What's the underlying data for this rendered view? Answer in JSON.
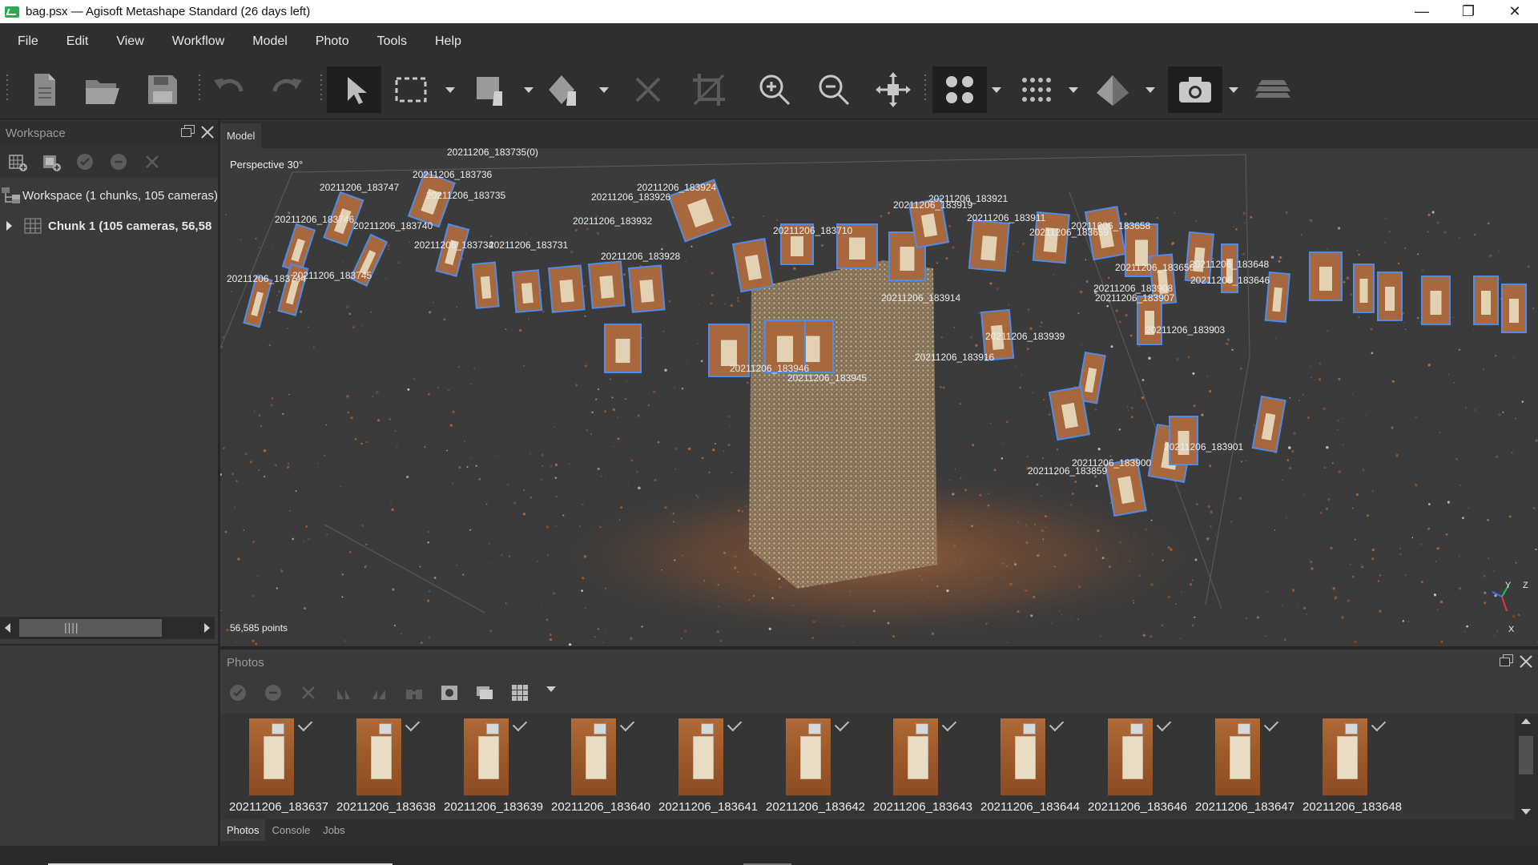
{
  "window": {
    "title": "bag.psx — Agisoft Metashape Standard (26 days left)"
  },
  "menu": [
    "File",
    "Edit",
    "View",
    "Workflow",
    "Model",
    "Photo",
    "Tools",
    "Help"
  ],
  "workspace": {
    "title": "Workspace",
    "root": "Workspace (1 chunks, 105 cameras)",
    "chunk": "Chunk 1 (105 cameras, 56,58"
  },
  "model": {
    "tab": "Model",
    "projection": "Perspective 30°",
    "points": "56,585 points",
    "axis": {
      "y": "Y",
      "z": "Z",
      "x": "X"
    },
    "camera_labels": [
      "20211206_183735(0)",
      "20211206_183747",
      "20211206_183736",
      "20211206_183735",
      "20211206_183746",
      "20211206_183740",
      "20211206_183745",
      "20211206_183744",
      "20211206_183734",
      "20211206_183731",
      "20211206_183926",
      "20211206_183924",
      "20211206_183932",
      "20211206_183928",
      "20211206_183710",
      "20211206_183921",
      "20211206_183919",
      "20211206_183911",
      "20211206_183658",
      "20211206_183659",
      "20211206_183914",
      "20211206_183939",
      "20211206_183916",
      "20211206_183908",
      "20211206_183907",
      "20211206_183903",
      "20211206_183650",
      "20211206_183648",
      "20211206_183646",
      "20211206_183945",
      "20211206_183946",
      "20211206_183900",
      "20211206_183859",
      "20211206_183901"
    ]
  },
  "photos": {
    "title": "Photos",
    "items": [
      "20211206_183637",
      "20211206_183638",
      "20211206_183639",
      "20211206_183640",
      "20211206_183641",
      "20211206_183642",
      "20211206_183643",
      "20211206_183644",
      "20211206_183646",
      "20211206_183647",
      "20211206_183648"
    ],
    "tabs": [
      "Photos",
      "Console",
      "Jobs"
    ]
  }
}
